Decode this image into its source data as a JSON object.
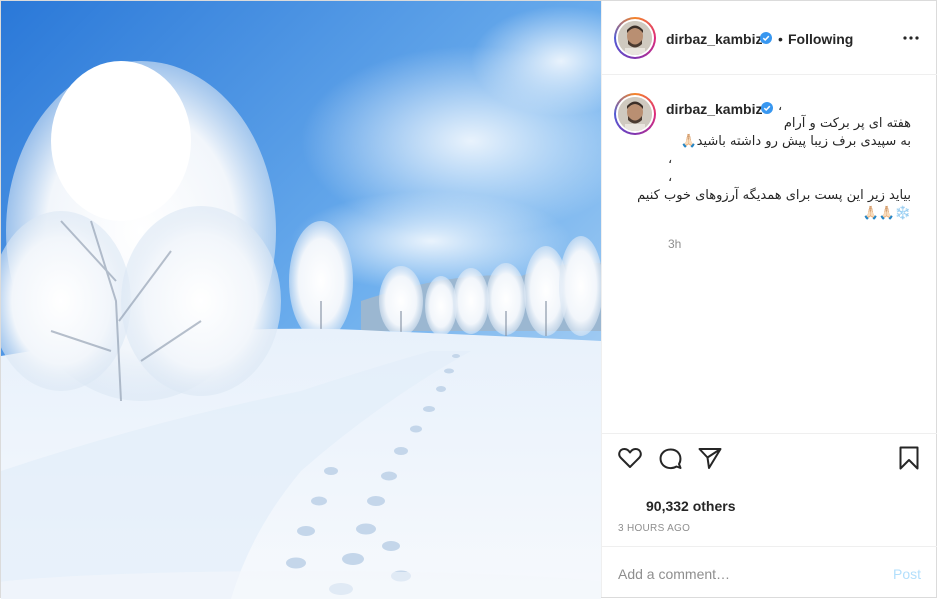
{
  "post": {
    "username": "dirbaz_kambiz",
    "follow_separator": "•",
    "follow_label": "Following",
    "more_icon": "more-options-icon"
  },
  "caption": {
    "separator": "،",
    "lines": [
      "هفته ای پر برکت و آرام",
      "به سپیدی برف زیبا پیش رو داشته باشید🙏🏻",
      "،",
      "،",
      "بیاید زیر این پست برای همدیگه آرزوهای خوب کنیم",
      "❄️🙏🏻🙏🏻"
    ],
    "time_ago": "3h"
  },
  "actions": {
    "like_icon": "heart-icon",
    "comment_icon": "comment-icon",
    "share_icon": "share-icon",
    "save_icon": "bookmark-icon"
  },
  "likes_text": "90,332 others",
  "timestamp": "3 HOURS AGO",
  "comment": {
    "placeholder": "Add a comment…",
    "post_label": "Post"
  },
  "colors": {
    "verified_blue": "#3897f0",
    "post_button": "#b2dffc",
    "muted_text": "#8e8e8e",
    "sky": "#4d95e6"
  }
}
